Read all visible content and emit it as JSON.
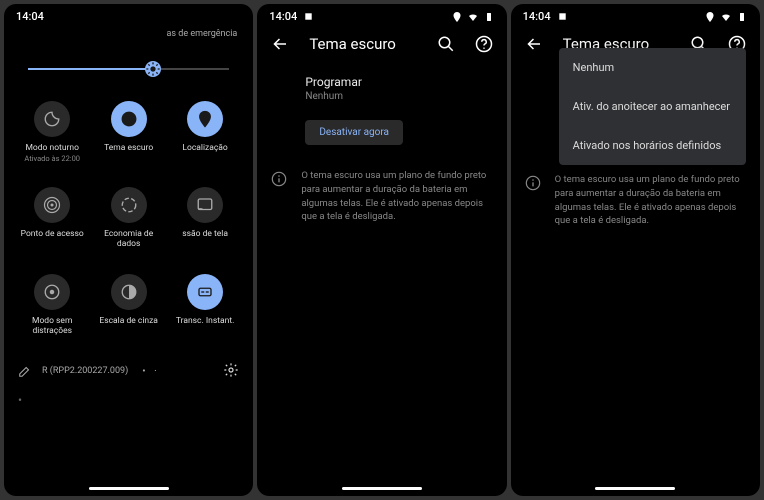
{
  "status": {
    "time": "14:04"
  },
  "screen1": {
    "header_chip": "as de emergência",
    "tiles": [
      {
        "label": "Modo noturno",
        "sublabel": "Ativado às 22:00"
      },
      {
        "label": "Tema escuro",
        "sublabel": ""
      },
      {
        "label": "Localização",
        "sublabel": ""
      },
      {
        "label": "Ponto de acesso",
        "sublabel": ""
      },
      {
        "label": "Economia de dados",
        "sublabel": ""
      },
      {
        "label": "ssão de tela",
        "sublabel": ""
      },
      {
        "label": "Modo sem distrações",
        "sublabel": ""
      },
      {
        "label": "Escala de cinza",
        "sublabel": ""
      },
      {
        "label": "Transc. Instant.",
        "sublabel": ""
      }
    ],
    "build": "R (RPP2.200227.009)"
  },
  "screen2": {
    "title": "Tema escuro",
    "schedule_label": "Programar",
    "schedule_value": "Nenhum",
    "action_button": "Desativar agora",
    "info": "O tema escuro usa um plano de fundo preto para aumentar a duração da bateria em algumas telas. Ele é ativado apenas depois que a tela é desligada."
  },
  "screen3": {
    "title": "Tema escuro",
    "options": [
      "Nenhum",
      "Ativ. do anoitecer ao amanhecer",
      "Ativado nos horários definidos"
    ],
    "info": "O tema escuro usa um plano de fundo preto para aumentar a duração da bateria em algumas telas. Ele é ativado apenas depois que a tela é desligada."
  }
}
